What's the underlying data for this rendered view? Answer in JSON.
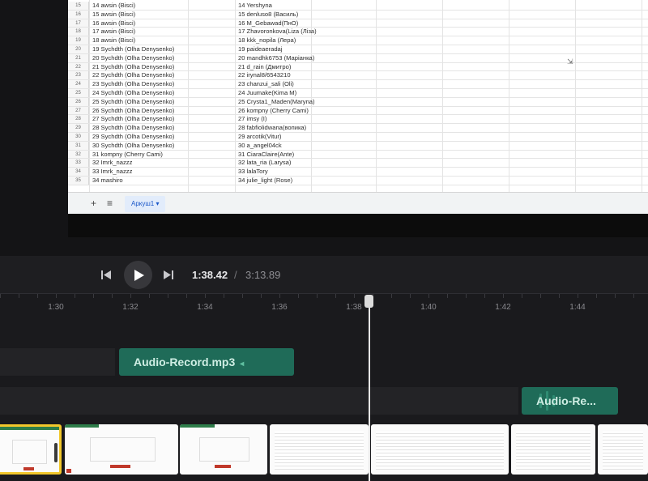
{
  "spreadsheet": {
    "rows": [
      {
        "num": "15",
        "a": "14  awsin (Bisci)",
        "b": "14  Yershyna"
      },
      {
        "num": "16",
        "a": "15  awsin (Bisci)",
        "b": "15  denluso8 (Василь)"
      },
      {
        "num": "17",
        "a": "16  awsin (Bisci)",
        "b": "16  M_Gebawad(ПнО)"
      },
      {
        "num": "18",
        "a": "17  awsin (Bisci)",
        "b": "17  Zhavoronkova(Liza (Ліза)"
      },
      {
        "num": "19",
        "a": "18  awsin (Bisci)",
        "b": "18  kkk_nopila (Лера)"
      },
      {
        "num": "20",
        "a": "19  Sychdth (Olha Denysenko)",
        "b": "19  paideaeradaj"
      },
      {
        "num": "21",
        "a": "20  Sychdth (Olha Denysenko)",
        "b": "20  mandhk6753 (Маріанка)"
      },
      {
        "num": "22",
        "a": "21  Sychdth (Olha Denysenko)",
        "b": "21  d_rain (Дмитро)"
      },
      {
        "num": "23",
        "a": "22  Sychdth (Olha Denysenko)",
        "b": "22  irynal8/6543210"
      },
      {
        "num": "24",
        "a": "23  Sychdth (Olha Denysenko)",
        "b": "23  chanzui_sali (Oli)"
      },
      {
        "num": "25",
        "a": "24  Sychdth (Olha Denysenko)",
        "b": "24  Juumake(Kima M)"
      },
      {
        "num": "26",
        "a": "25  Sychdth (Olha Denysenko)",
        "b": "25  Crysta1_Maden(Maryna)"
      },
      {
        "num": "27",
        "a": "26  Sychdth (Olha Denysenko)",
        "b": "26  kompny (Cherry Cami)"
      },
      {
        "num": "28",
        "a": "27  Sychdth (Olha Denysenko)",
        "b": "27  imsy (I)"
      },
      {
        "num": "29",
        "a": "28  Sychdth (Olha Denysenko)",
        "b": "28  fabfiolidwana(вопика)"
      },
      {
        "num": "30",
        "a": "29  Sychdth (Olha Denysenko)",
        "b": "29  arcotik(Vitur)"
      },
      {
        "num": "31",
        "a": "30  Sychdth (Olha Denysenko)",
        "b": "30  a_angel04ck"
      },
      {
        "num": "32",
        "a": "31  kompny (Cherry Cami)",
        "b": "31  CiaraClaire(Ante)"
      },
      {
        "num": "33",
        "a": "32  Imrk_nazzz",
        "b": "32  lata_ria (Larysa)"
      },
      {
        "num": "34",
        "a": "33  Imrk_nazzz",
        "b": "33  lalaTory"
      },
      {
        "num": "35",
        "a": "34  mashiro",
        "b": "34  julie_light (Rose)"
      }
    ],
    "tabs": {
      "add": "+",
      "menu": "≡",
      "sheet_name": "Аркуш1 ▾"
    }
  },
  "transport": {
    "current_time": "1:38.42",
    "separator": "/",
    "total_time": "3:13.89"
  },
  "ruler": {
    "labels": [
      "1:30",
      "1:32",
      "1:34",
      "1:36",
      "1:38",
      "1:40",
      "1:42",
      "1:44"
    ]
  },
  "tracks": {
    "clip1": "Audio-Record.mp3",
    "clip2": "Audio-Re..."
  },
  "colors": {
    "clip_bg": "#1f6b58",
    "clip_text": "#cfeee4",
    "selected_thumb_border": "#f2c72b"
  }
}
